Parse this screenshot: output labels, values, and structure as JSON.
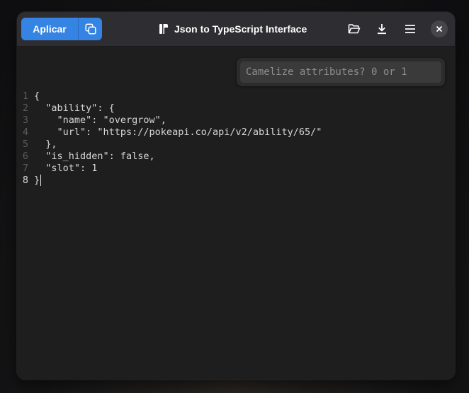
{
  "window": {
    "title": "Json to TypeScript Interface"
  },
  "headerbar": {
    "apply_label": "Aplicar",
    "apply_color": "#3584e4",
    "icons": {
      "copy": "copy-icon",
      "open": "folder-open-icon",
      "download": "download-icon",
      "menu": "hamburger-menu-icon",
      "close": "close-icon",
      "app": "app-logo-icon"
    }
  },
  "camelize": {
    "placeholder": "Camelize attributes? 0 or 1",
    "value": ""
  },
  "editor": {
    "lines": [
      {
        "number": "1",
        "text": "{"
      },
      {
        "number": "2",
        "text": "  \"ability\": {"
      },
      {
        "number": "3",
        "text": "    \"name\": \"overgrow\","
      },
      {
        "number": "4",
        "text": "    \"url\": \"https://pokeapi.co/api/v2/ability/65/\""
      },
      {
        "number": "5",
        "text": "  },"
      },
      {
        "number": "6",
        "text": "  \"is_hidden\": false,"
      },
      {
        "number": "7",
        "text": "  \"slot\": 1"
      },
      {
        "number": "8",
        "text": "}"
      }
    ],
    "current_line": "8"
  }
}
